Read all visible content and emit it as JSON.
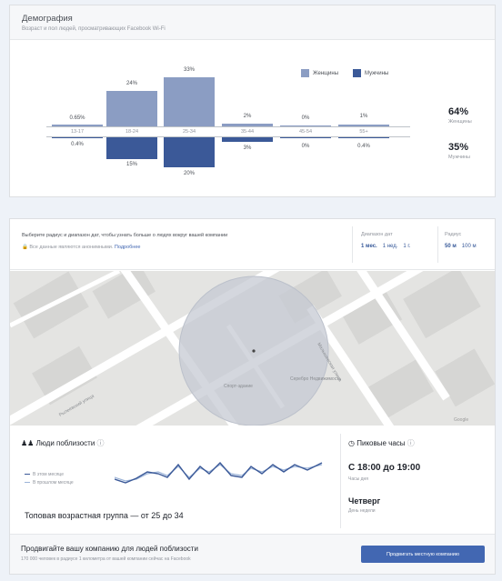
{
  "demographics": {
    "title": "Демография",
    "subtitle": "Возраст и пол людей, просматривающих Facebook Wi-Fi",
    "legend": {
      "women": "Женщины",
      "men": "Мужчины"
    },
    "colors": {
      "women": "#8b9dc3",
      "men": "#3b5998"
    },
    "age_groups": [
      {
        "label": "13-17",
        "women": "0.65%",
        "men": "0.4%"
      },
      {
        "label": "18-24",
        "women": "24%",
        "men": "15%"
      },
      {
        "label": "25-34",
        "women": "33%",
        "men": "20%"
      },
      {
        "label": "35-44",
        "women": "2%",
        "men": "3%"
      },
      {
        "label": "45-54",
        "women": "0%",
        "men": "0%"
      },
      {
        "label": "55+",
        "women": "1%",
        "men": "0.4%"
      }
    ],
    "totals": {
      "women_pct": "64%",
      "women_label": "Женщины",
      "men_pct": "35%",
      "men_label": "Мужчины"
    }
  },
  "chart_data": {
    "type": "bar",
    "categories": [
      "13-17",
      "18-24",
      "25-34",
      "35-44",
      "45-54",
      "55+"
    ],
    "series": [
      {
        "name": "Женщины",
        "values": [
          0.65,
          24,
          33,
          2,
          0,
          1
        ]
      },
      {
        "name": "Мужчины",
        "values": [
          0.4,
          15,
          20,
          3,
          0,
          0.4
        ]
      }
    ],
    "legend": "top-right"
  },
  "map_section": {
    "description": "Выберите радиус и диапазон дат, чтобы узнать больше о людях вокруг вашей компании",
    "info_text": "Все данные являются анонимными.",
    "info_link": "Подробнее",
    "date_range": {
      "label": "Диапазон дат",
      "options": [
        "1 мес.",
        "1 нед.",
        "1 г."
      ]
    },
    "radius": {
      "label": "Радиус",
      "options": [
        "50 м",
        "100 м"
      ]
    },
    "map": {
      "street_1": "Рылеевский улица",
      "street_2": "Малышевская улица",
      "poi_1": "Спорт-здание",
      "poi_2": "Серебро Недвижимость",
      "attribution": "Google"
    }
  },
  "nearby": {
    "title": "Люди поблизости",
    "legend_current": "В этом месяце",
    "legend_previous": "В прошлом месяце",
    "top_age": "Топовая возрастная группа — от 25 до 34",
    "series_colors": {
      "current": "#3b5998",
      "previous": "#9cb4d8"
    }
  },
  "peak": {
    "title": "Пиковые часы",
    "time": "С 18:00 до 19:00",
    "time_label": "Часы дня",
    "day": "Четверг",
    "day_label": "День недели"
  },
  "promo": {
    "title": "Продвигайте вашу компанию для людей поблизости",
    "subtitle": "170 000 человек в радиусе 1 километра от вашей компании сейчас на Facebook",
    "button": "Продвигать местную компанию"
  }
}
